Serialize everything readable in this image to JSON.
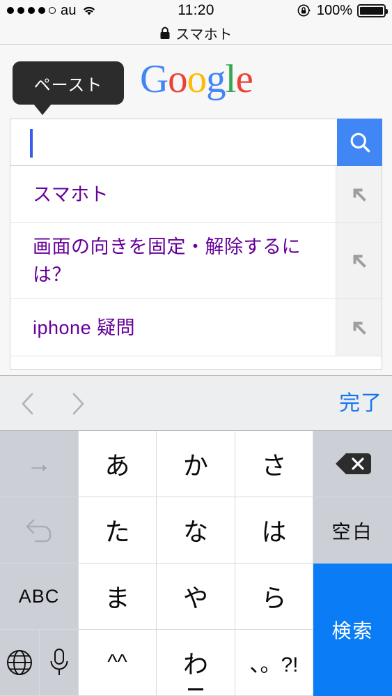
{
  "status_bar": {
    "signal_icon": "signal-dots",
    "signal_filled": 4,
    "signal_total": 5,
    "carrier": "au",
    "wifi_icon": "wifi-icon",
    "time": "11:20",
    "rotation_lock_icon": "rotation-lock-icon",
    "battery_percent": "100%",
    "battery_icon": "battery-full-icon"
  },
  "page_title": {
    "lock_icon": "lock-icon",
    "host": "スマホト"
  },
  "tooltip": {
    "label": "ペースト",
    "icon": "callout-arrow-down"
  },
  "logo": {
    "name": "google-logo",
    "letters": [
      {
        "ch": "G",
        "color": "#4285f4"
      },
      {
        "ch": "o",
        "color": "#ea4335"
      },
      {
        "ch": "o",
        "color": "#fbbc05"
      },
      {
        "ch": "g",
        "color": "#4285f4"
      },
      {
        "ch": "l",
        "color": "#34a853"
      },
      {
        "ch": "e",
        "color": "#ea4335"
      }
    ]
  },
  "search": {
    "value": "",
    "placeholder": "",
    "button_icon": "search-magnifier-icon",
    "button_color": "#4086f4",
    "caret_color": "#3b5bf0"
  },
  "suggestions": {
    "arrow_icon": "arrow-up-left-icon",
    "link_color": "#660099",
    "items": [
      {
        "text": "スマホト"
      },
      {
        "text": "画面の向きを固定・解除するには？"
      },
      {
        "text": "iphone 疑問"
      }
    ]
  },
  "accessory_bar": {
    "prev_icon": "chevron-left-icon",
    "next_icon": "chevron-right-icon",
    "done_label": "完了",
    "done_color": "#1474f0"
  },
  "keyboard": {
    "type": "japanese-kana-12key",
    "keys": {
      "next_candidate": "→",
      "undo": "↺",
      "abc": "ABC",
      "globe": "globe-icon",
      "mic": "microphone-icon",
      "a": "あ",
      "ka": "か",
      "sa": "さ",
      "ta": "た",
      "na": "な",
      "ha": "は",
      "ma": "ま",
      "ya": "や",
      "ra": "ら",
      "emoji": "^^",
      "wa": "わ",
      "punct": "、。?!",
      "backspace": "backspace-icon",
      "space": "空白",
      "search": "検索"
    },
    "search_key_color": "#0a7cf5"
  }
}
